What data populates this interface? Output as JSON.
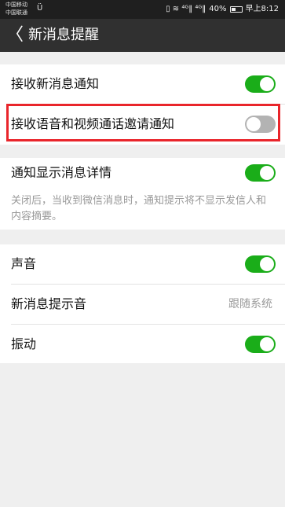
{
  "status_bar": {
    "carrier_1": "中国移动",
    "carrier_2": "中国联通",
    "carrier_extra": "Ü",
    "icons_text": "▯ ≋ ⁴ᴳ‖ ⁴ᴳ‖",
    "battery_percent": "40%",
    "time": "早上8:12"
  },
  "app_bar": {
    "back_icon": "〈",
    "title": "新消息提醒"
  },
  "section_1": {
    "row_new_message": {
      "label": "接收新消息通知",
      "enabled": true
    },
    "row_voice_video": {
      "label": "接收语音和视频通话邀请通知",
      "enabled": false
    }
  },
  "section_2": {
    "row_show_details": {
      "label": "通知显示消息详情",
      "enabled": true
    },
    "description": "关闭后，当收到微信消息时，通知提示将不显示发信人和内容摘要。"
  },
  "section_3": {
    "row_sound": {
      "label": "声音",
      "enabled": true
    },
    "row_tone": {
      "label": "新消息提示音",
      "value": "跟随系统"
    },
    "row_vibrate": {
      "label": "振动",
      "enabled": true
    }
  },
  "colors": {
    "toggle_on": "#1aad19",
    "toggle_off": "#b3b3b3",
    "highlight_border": "#e9252b",
    "app_bar": "#303030"
  }
}
